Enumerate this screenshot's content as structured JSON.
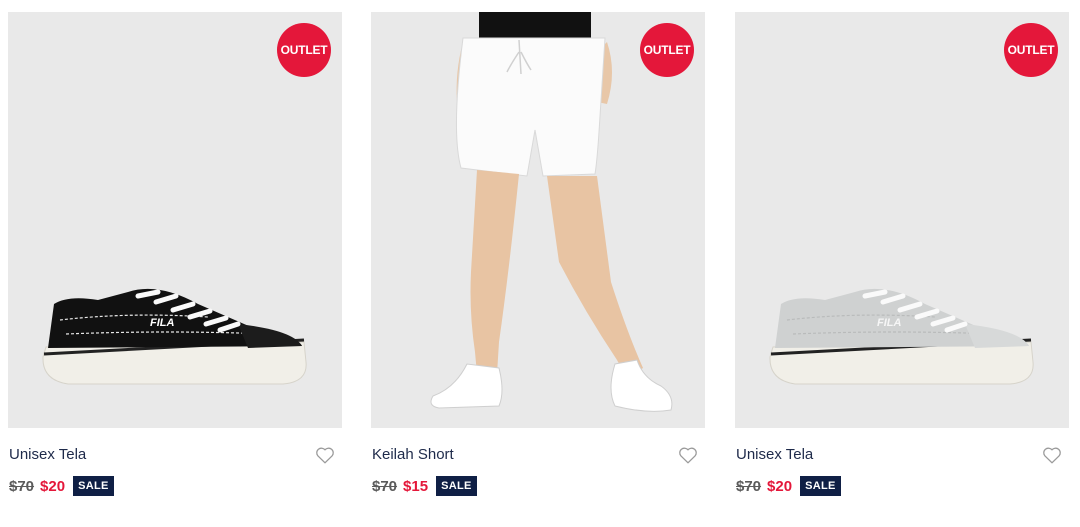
{
  "products": [
    {
      "name": "Unisex Tela",
      "badge": "OUTLET",
      "was_price": "$70",
      "now_price": "$20",
      "sale_label": "SALE",
      "image": "black-canvas-sneaker",
      "logo_text": "FILA"
    },
    {
      "name": "Keilah Short",
      "badge": "OUTLET",
      "was_price": "$70",
      "now_price": "$15",
      "sale_label": "SALE",
      "image": "white-shorts-model"
    },
    {
      "name": "Unisex Tela",
      "badge": "OUTLET",
      "was_price": "$70",
      "now_price": "$20",
      "sale_label": "SALE",
      "image": "grey-canvas-sneaker",
      "logo_text": "FILA"
    }
  ],
  "colors": {
    "badge": "#e4173a",
    "sale_price": "#e4173a",
    "sale_tag": "#0f1f45",
    "name_text": "#1e2a4a",
    "image_bg": "#e9e9e9"
  },
  "icons": {
    "wishlist": "heart-outline-icon"
  }
}
